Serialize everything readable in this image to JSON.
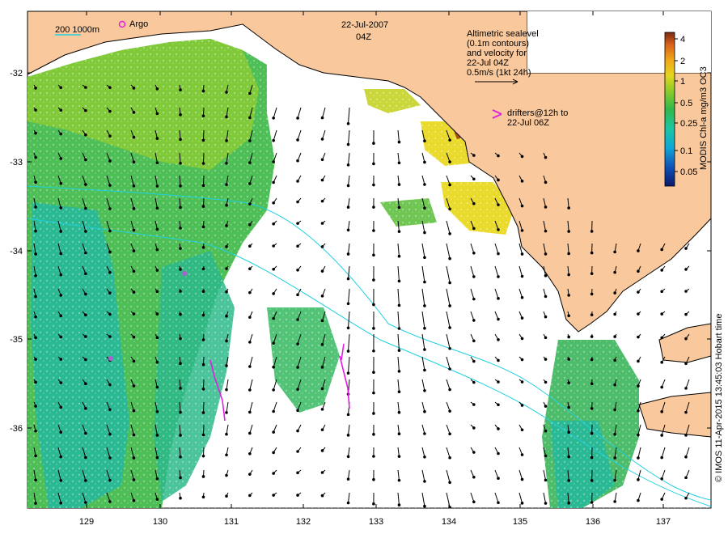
{
  "header": {
    "date": "22-Jul-2007",
    "time": "04Z"
  },
  "legend": {
    "scale_label": "200  1000m",
    "argo_label": "Argo",
    "altimetry": [
      "Altimetric sealevel",
      "(0.1m contours)",
      "and velocity for",
      "22-Jul 04Z",
      "0.5m/s (1kt 24h)"
    ],
    "drifters": [
      "drifters@12h to",
      "22-Jul 06Z"
    ]
  },
  "colorbar": {
    "title": "MODIS Chl-a mg/m3 OC3",
    "ticks": [
      "4",
      "2",
      "1",
      "0.5",
      "0.25",
      "0.1",
      "0.05"
    ],
    "colors": [
      "#0b1a6b",
      "#0e4fb4",
      "#11a6d8",
      "#1cc6a0",
      "#32b84a",
      "#8ccc2a",
      "#e6d51e",
      "#f0a818",
      "#d8621a",
      "#7a2a10"
    ]
  },
  "credit": "© IMOS 11-Apr-2015 13:45:03 Hobart time",
  "axes": {
    "x_ticks": [
      "129",
      "130",
      "131",
      "132",
      "133",
      "134",
      "135",
      "136",
      "137"
    ],
    "y_ticks": [
      "-32",
      "-33",
      "-34",
      "-35",
      "-36"
    ],
    "lon_range": [
      128.2,
      137.5
    ],
    "lat_range": [
      -31.3,
      -36.9
    ]
  },
  "colors": {
    "land": "#f9c89c",
    "coast": "#000000",
    "chl_high": "#7a3a10",
    "chl_mid": "#e8d820",
    "chl_green": "#3fb848",
    "chl_teal": "#27b89a",
    "bathy": "#20d0e0",
    "drifter": "#e020e0",
    "vector": "#000000"
  }
}
